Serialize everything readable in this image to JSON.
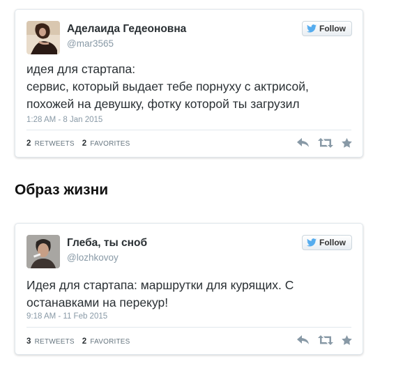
{
  "tweets": [
    {
      "display_name": "Аделаида Гедеоновна",
      "screen_name": "@mar3565",
      "follow_label": "Follow",
      "text_lines": [
        "идея для стартапа:",
        "сервис, который выдает тебе порнуху с актрисой,",
        "похожей на девушку, фотку которой ты загрузил"
      ],
      "timestamp": "1:28 AM - 8 Jan 2015",
      "retweets_count": "2",
      "retweets_label": "RETWEETS",
      "favorites_count": "2",
      "favorites_label": "FAVORITES"
    },
    {
      "display_name": "Глеба, ты сноб",
      "screen_name": "@lozhkovoy",
      "follow_label": "Follow",
      "text_lines": [
        "Идея для стартапа: маршрутки для курящих. С",
        "останавками на перекур!"
      ],
      "timestamp": "9:18 AM - 11 Feb 2015",
      "retweets_count": "3",
      "retweets_label": "RETWEETS",
      "favorites_count": "2",
      "favorites_label": "FAVORITES"
    }
  ],
  "section_heading": "Образ жизни",
  "icons": {
    "follow": "twitter-bird-icon",
    "reply": "reply-icon",
    "retweet": "retweet-icon",
    "favorite": "star-icon"
  },
  "colors": {
    "bird": "#55acee",
    "secondary_text": "#8899a6",
    "action_icon": "#8899a6"
  }
}
